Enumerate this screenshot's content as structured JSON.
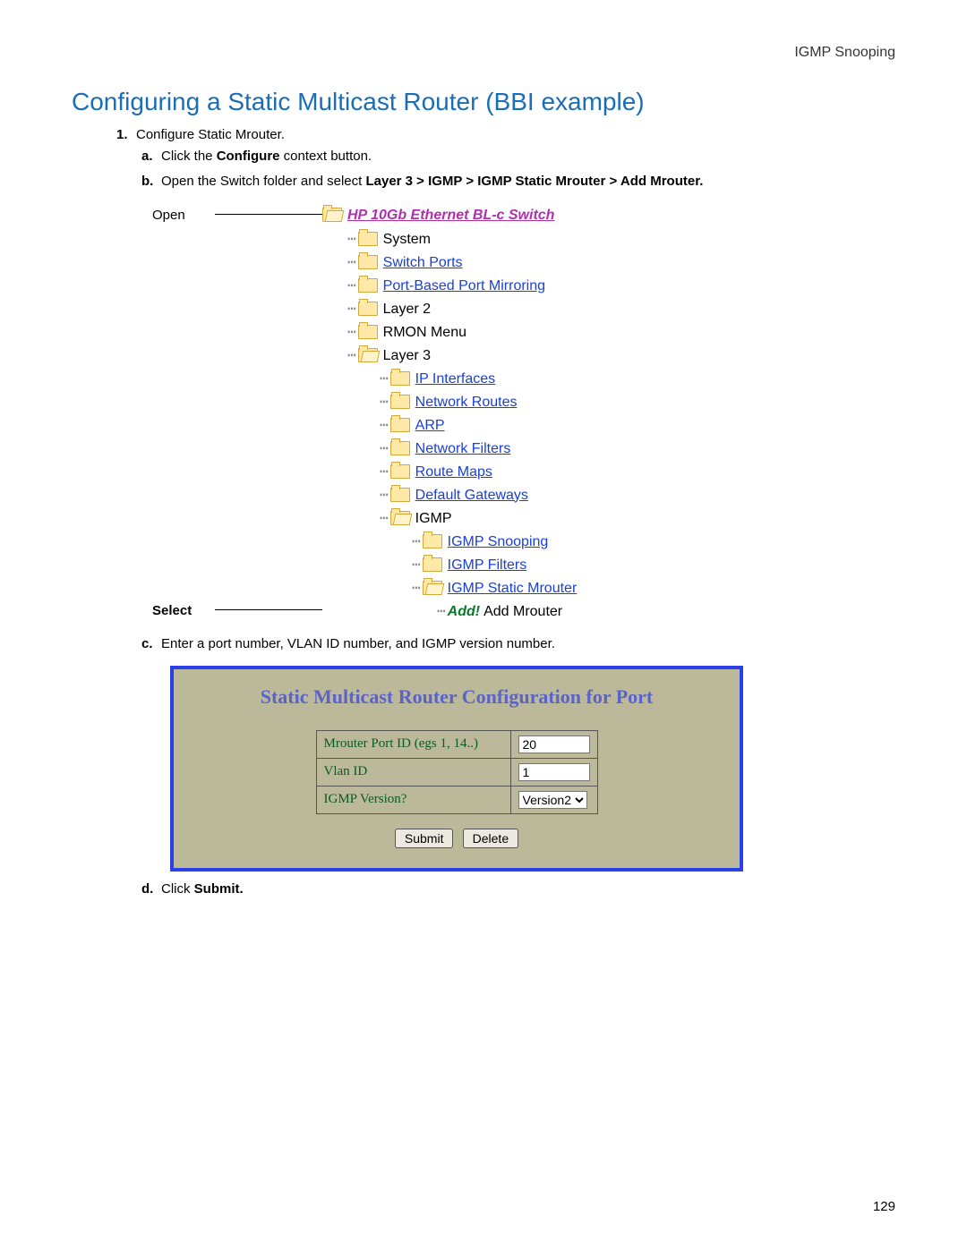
{
  "header": {
    "right": "IGMP Snooping"
  },
  "title": "Configuring a Static Multicast Router (BBI example)",
  "step1": {
    "num": "1.",
    "text": "Configure Static Mrouter.",
    "a": {
      "letter": "a.",
      "before": "Click the ",
      "bold": "Configure",
      "after": " context button."
    },
    "b": {
      "letter": "b.",
      "before": "Open the Switch folder and select ",
      "bold": "Layer 3 > IGMP > IGMP Static Mrouter > Add Mrouter."
    },
    "c": {
      "letter": "c.",
      "text": "Enter a port number, VLAN ID number, and IGMP version number."
    },
    "d": {
      "letter": "d.",
      "before": "Click ",
      "bold": "Submit."
    }
  },
  "tree": {
    "open_label": "Open",
    "select_label": "Select",
    "root": "HP 10Gb Ethernet BL-c Switch",
    "l1": {
      "system": "System",
      "switch_ports": "Switch Ports",
      "port_mirror": "Port-Based Port Mirroring",
      "layer2": "Layer 2",
      "rmon": "RMON Menu",
      "layer3": "Layer 3"
    },
    "l3": {
      "ip_if": "IP Interfaces",
      "net_routes": "Network Routes",
      "arp": "ARP",
      "net_filters": "Network Filters",
      "route_maps": "Route Maps",
      "def_gw": "Default Gateways",
      "igmp": "IGMP"
    },
    "igmp": {
      "snooping": "IGMP Snooping",
      "filters": "IGMP Filters",
      "static_mr": "IGMP Static Mrouter"
    },
    "add": {
      "label": "Add!",
      "text": "Add Mrouter"
    }
  },
  "form": {
    "title": "Static Multicast Router Configuration for Port",
    "row1": {
      "label": "Mrouter Port ID (egs 1, 14..)",
      "value": "20"
    },
    "row2": {
      "label": "Vlan ID",
      "value": "1"
    },
    "row3": {
      "label": "IGMP Version?",
      "value": "Version2"
    },
    "submit": "Submit",
    "delete": "Delete"
  },
  "page_number": "129"
}
